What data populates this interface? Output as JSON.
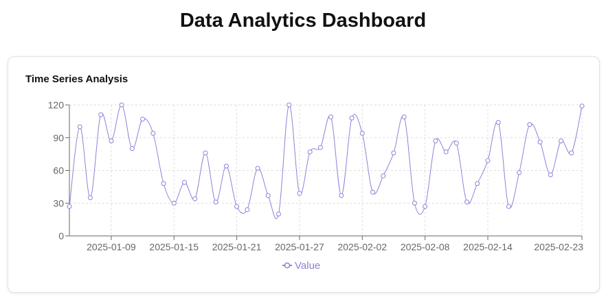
{
  "page": {
    "title": "Data Analytics Dashboard"
  },
  "card": {
    "title": "Time Series Analysis"
  },
  "colors": {
    "series": "#8884d8",
    "grid": "#dddddd",
    "axis": "#666666"
  },
  "chart_data": {
    "type": "line",
    "title": "Time Series Analysis",
    "xlabel": "",
    "ylabel": "",
    "ylim": [
      0,
      120
    ],
    "yticks": [
      0,
      30,
      60,
      90,
      120
    ],
    "x_start": "2025-01-05",
    "x_end": "2025-02-23",
    "xticks": [
      "2025-01-09",
      "2025-01-15",
      "2025-01-21",
      "2025-01-27",
      "2025-02-02",
      "2025-02-08",
      "2025-02-14",
      "2025-02-23"
    ],
    "grid": true,
    "legend_position": "bottom",
    "series": [
      {
        "name": "Value",
        "values": [
          27,
          100,
          35,
          111,
          87,
          120,
          80,
          107,
          94,
          48,
          30,
          49,
          34,
          76,
          31,
          64,
          27,
          24,
          62,
          37,
          20,
          120,
          39,
          77,
          81,
          109,
          37,
          108,
          94,
          40,
          55,
          76,
          109,
          30,
          27,
          87,
          77,
          85,
          31,
          48,
          69,
          104,
          27,
          58,
          102,
          86,
          56,
          87,
          76,
          119
        ]
      }
    ]
  }
}
